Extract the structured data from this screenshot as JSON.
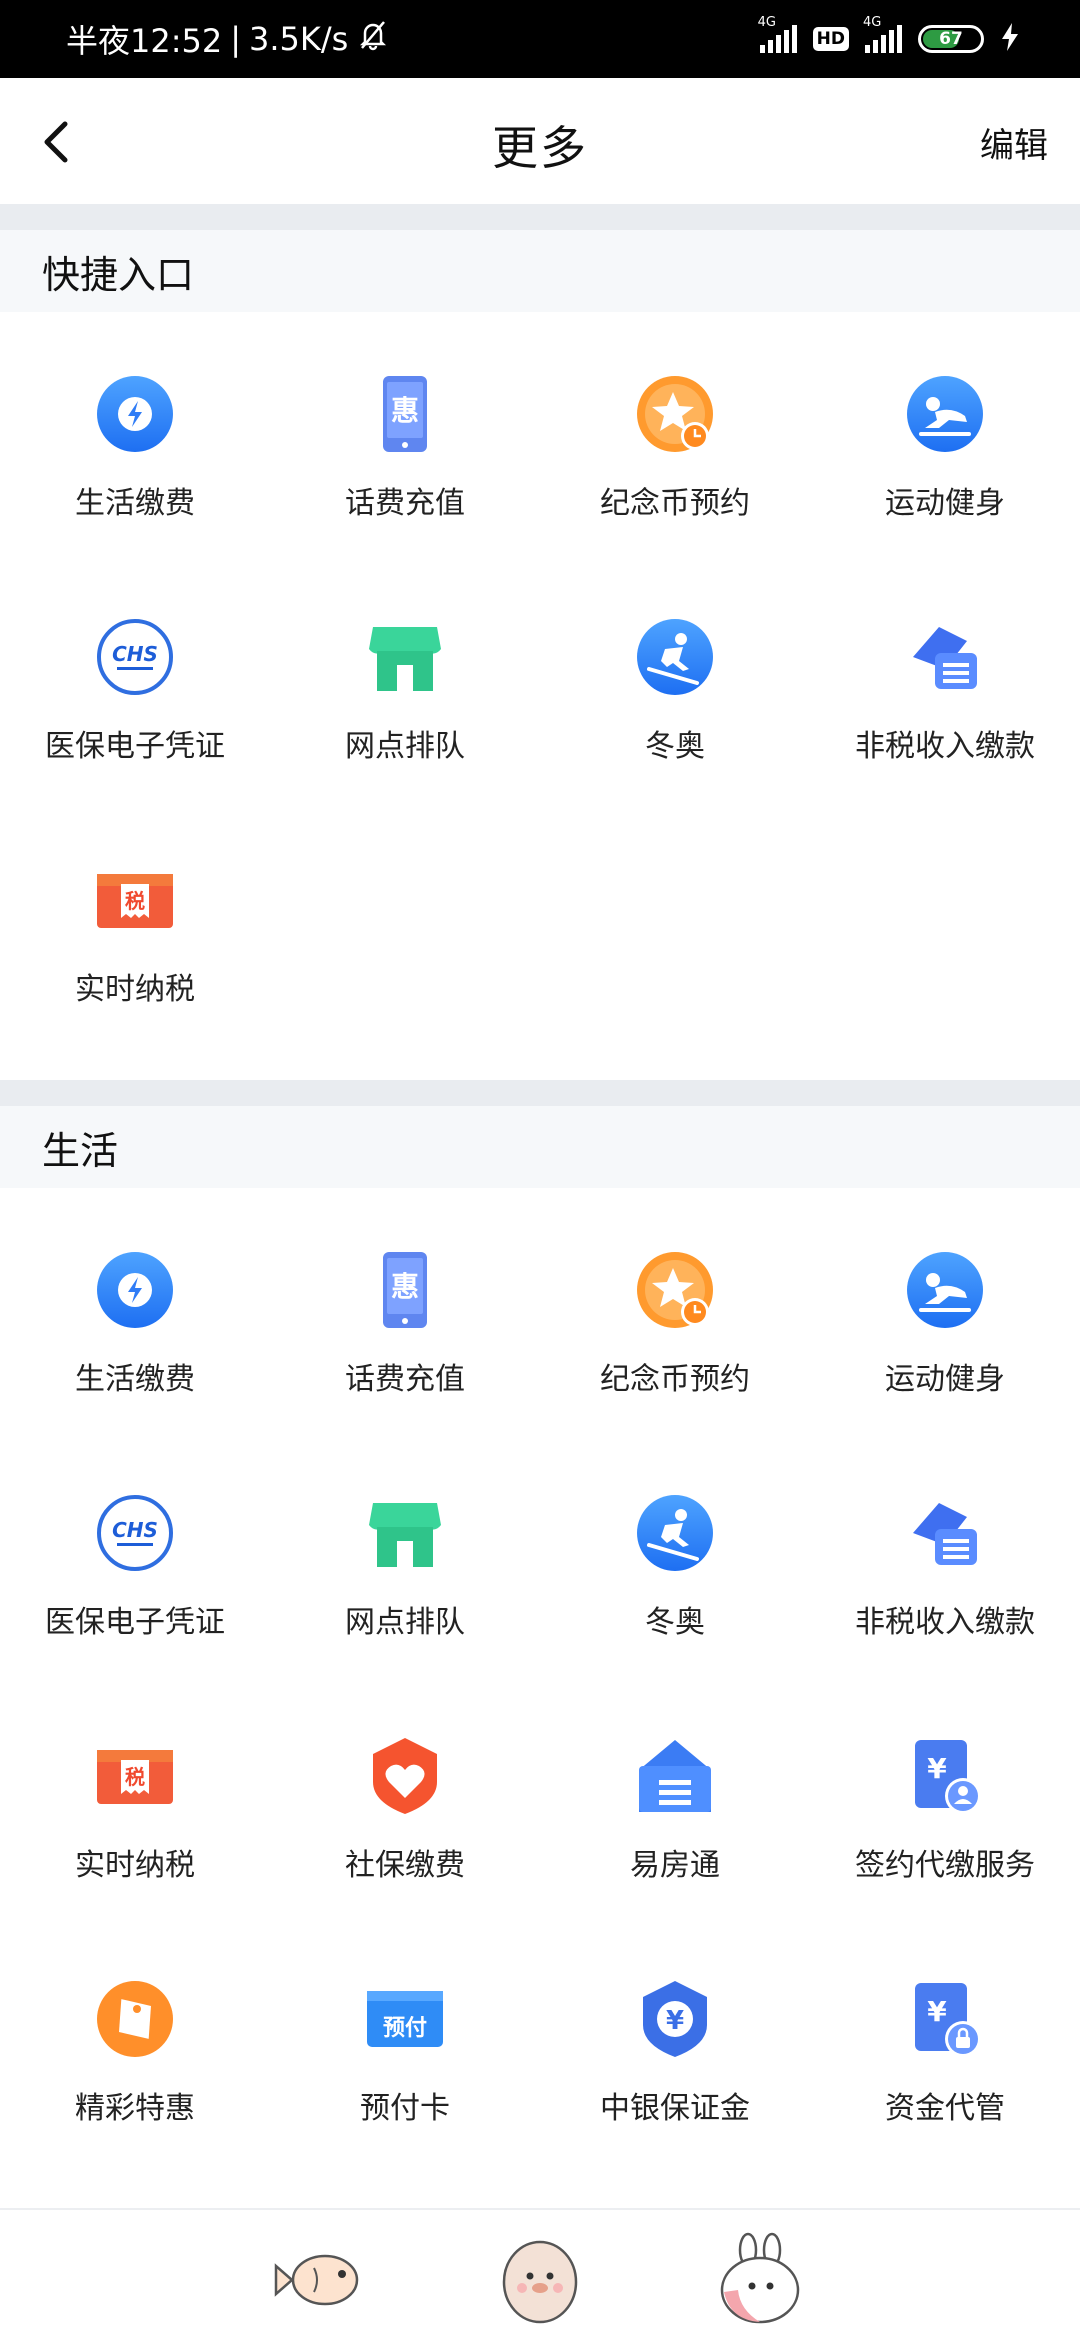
{
  "status": {
    "time": "半夜12:52",
    "speed": "3.5K/s",
    "net1": "4G",
    "hd": "HD",
    "net2": "4G",
    "battery": "67"
  },
  "nav": {
    "title": "更多",
    "edit": "编辑"
  },
  "quick": {
    "title": "快捷入口",
    "items": [
      {
        "label": "生活缴费",
        "icon": "lightning-icon"
      },
      {
        "label": "话费充值",
        "icon": "phone-discount-icon"
      },
      {
        "label": "纪念币预约",
        "icon": "star-clock-icon"
      },
      {
        "label": "运动健身",
        "icon": "skating-icon"
      },
      {
        "label": "医保电子凭证",
        "icon": "chs-icon"
      },
      {
        "label": "网点排队",
        "icon": "shop-icon"
      },
      {
        "label": "冬奥",
        "icon": "skiing-icon"
      },
      {
        "label": "非税收入缴款",
        "icon": "stack-icon"
      },
      {
        "label": "实时纳税",
        "icon": "tax-icon"
      }
    ]
  },
  "life": {
    "title": "生活",
    "items": [
      {
        "label": "生活缴费",
        "icon": "lightning-icon"
      },
      {
        "label": "话费充值",
        "icon": "phone-discount-icon"
      },
      {
        "label": "纪念币预约",
        "icon": "star-clock-icon"
      },
      {
        "label": "运动健身",
        "icon": "skating-icon"
      },
      {
        "label": "医保电子凭证",
        "icon": "chs-icon"
      },
      {
        "label": "网点排队",
        "icon": "shop-icon"
      },
      {
        "label": "冬奥",
        "icon": "skiing-icon"
      },
      {
        "label": "非税收入缴款",
        "icon": "stack-icon"
      },
      {
        "label": "实时纳税",
        "icon": "tax-icon"
      },
      {
        "label": "社保缴费",
        "icon": "heart-shield-icon"
      },
      {
        "label": "易房通",
        "icon": "house-icon"
      },
      {
        "label": "签约代缴服务",
        "icon": "yen-user-icon"
      },
      {
        "label": "精彩特惠",
        "icon": "tag-icon"
      },
      {
        "label": "预付卡",
        "icon": "prepaid-card-icon"
      },
      {
        "label": "中银保证金",
        "icon": "yen-shield-icon"
      },
      {
        "label": "资金代管",
        "icon": "yen-lock-icon"
      }
    ]
  },
  "icon_text": {
    "discount": "惠",
    "chs": "CHS",
    "tax": "税",
    "prepaid": "预付",
    "yen": "¥"
  },
  "colors": {
    "blue": "#2f7cf6",
    "orange": "#ff8a1f",
    "green": "#3ccf8e",
    "red": "#f0492e",
    "gap": "#e9ecf0"
  },
  "bottom": {
    "stickers": [
      "fish-sticker-icon",
      "potato-sticker-icon",
      "bunny-sticker-icon"
    ]
  }
}
